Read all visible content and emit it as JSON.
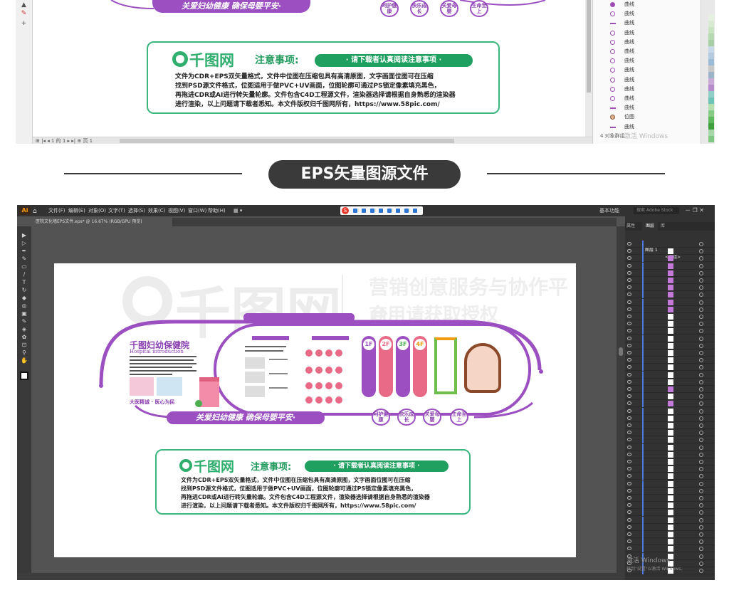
{
  "corel": {
    "status_page": "页 1",
    "objects": [
      {
        "kind": "filled",
        "label": "曲线"
      },
      {
        "kind": "ring",
        "label": "曲线"
      },
      {
        "kind": "dash",
        "label": "曲线"
      },
      {
        "kind": "ring",
        "label": "曲线"
      },
      {
        "kind": "ring",
        "label": "曲线"
      },
      {
        "kind": "ring",
        "label": "曲线"
      },
      {
        "kind": "ring",
        "label": "曲线"
      },
      {
        "kind": "ring",
        "label": "曲线"
      },
      {
        "kind": "ring",
        "label": "曲线"
      },
      {
        "kind": "ring",
        "label": "曲线"
      },
      {
        "kind": "ring",
        "label": "曲线"
      },
      {
        "kind": "dash",
        "label": "曲线"
      },
      {
        "kind": "img",
        "label": "位图"
      },
      {
        "kind": "dash",
        "label": "曲线"
      }
    ],
    "objects_footer": "4 对象群组",
    "watermark": "激活 Windows",
    "palette": [
      "#e6f0e0",
      "#d9ead3",
      "#c8e3c0",
      "#b5d9b0",
      "#a7cfa4",
      "#c7d8e8",
      "#b3cbe0",
      "#9bbbd6",
      "#c8c8c8",
      "#9fb3c8",
      "#c9a9d8",
      "#b88ccc",
      "#8fcfc8",
      "#6fc4b8",
      "#b4e0b0",
      "#87cc86",
      "#5eb85e",
      "#3f9f3f",
      "#a5d6a7",
      "#81c784"
    ]
  },
  "design": {
    "slogan": "关爱妇幼健康  确保母婴平安·",
    "badges": [
      "呵护健康",
      "快乐成长",
      "关爱母婴",
      "生命至上"
    ],
    "notice": {
      "logo_text": "千图网",
      "title": "注意事项:",
      "pill": "· 请下载者认真阅读注意事项 ·",
      "lines": [
        "文件为CDR+EPS双矢量格式，文件中位图在压缩包具有高清原图，文字画面位图可在压缩",
        "找到PSD源文件格式，位图适用于做PVC+UV画面，位图轮廓可通过PS锁定像素填充黑色，",
        "再拖进CDR或AI进行转矢量轮廓。文件包含C4D工程源文件，渲染器选择请根据自身熟悉的渲染器",
        "进行渲染，以上问题请下载者悉知。本文件版权归千图网所有，https://www.58pic.com/"
      ]
    },
    "hospital": {
      "title": "千图妇幼保健院",
      "subtitle": "Hospital introduction",
      "tagline": "大医精诚 · 医心为民"
    },
    "floors": [
      "1F",
      "2F",
      "3F",
      "4F"
    ],
    "watermark_brand": "营销创意服务与协作平台",
    "watermark_note": "商用请获取授权"
  },
  "heading": "EPS矢量图源文件",
  "ai": {
    "logo": "Ai",
    "menus": [
      "文件(F)",
      "编辑(E)",
      "对象(O)",
      "文字(T)",
      "选择(S)",
      "效果(C)",
      "视图(V)",
      "窗口(W)",
      "帮助(H)"
    ],
    "workspace": "基本功能",
    "search_placeholder": "搜索 Adobe Stock",
    "tab": "医院文化墙EPS文件.eps* @ 16.67% (RGB/GPU 预览)",
    "panel_tabs": [
      "属性",
      "图层",
      "库"
    ],
    "layer_name": "图层 1",
    "group_name": "<编组>",
    "watermark": "激活 Windows",
    "watermark_sub": "转到\"设置\"以激活 Windows。"
  }
}
